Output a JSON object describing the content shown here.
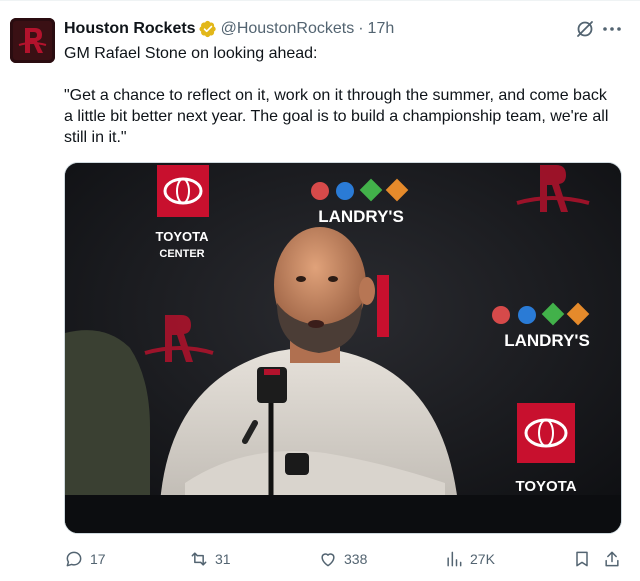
{
  "author": {
    "name": "Houston Rockets",
    "handle": "@HoustonRockets",
    "separator": "·",
    "time": "17h",
    "verified": true,
    "avatar_icon": "rockets-logo-icon"
  },
  "header_icons": [
    "grok-icon",
    "more-icon"
  ],
  "tweet": {
    "line1": "GM Rafael Stone on looking ahead:",
    "line2": "\"Get a chance to reflect on it, work on it through the summer, and come back a little bit better next year. The goal is to build a championship team, we're all still in it.\""
  },
  "media": {
    "description_icons": [
      "toyota-logo-icon",
      "rockets-logo-icon",
      "landrys-logo-icon"
    ],
    "backdrop_text": {
      "toyota_center_1": "TOYOTA",
      "toyota_center_2": "CENTER",
      "landrys": "LANDRY'S"
    }
  },
  "actions": {
    "replies": "17",
    "retweets": "31",
    "likes": "338",
    "views": "27K"
  },
  "colors": {
    "text_primary": "#0f1419",
    "text_secondary": "#536471",
    "verified_gold": "#e2b719",
    "rockets_red": "#ce1141"
  }
}
